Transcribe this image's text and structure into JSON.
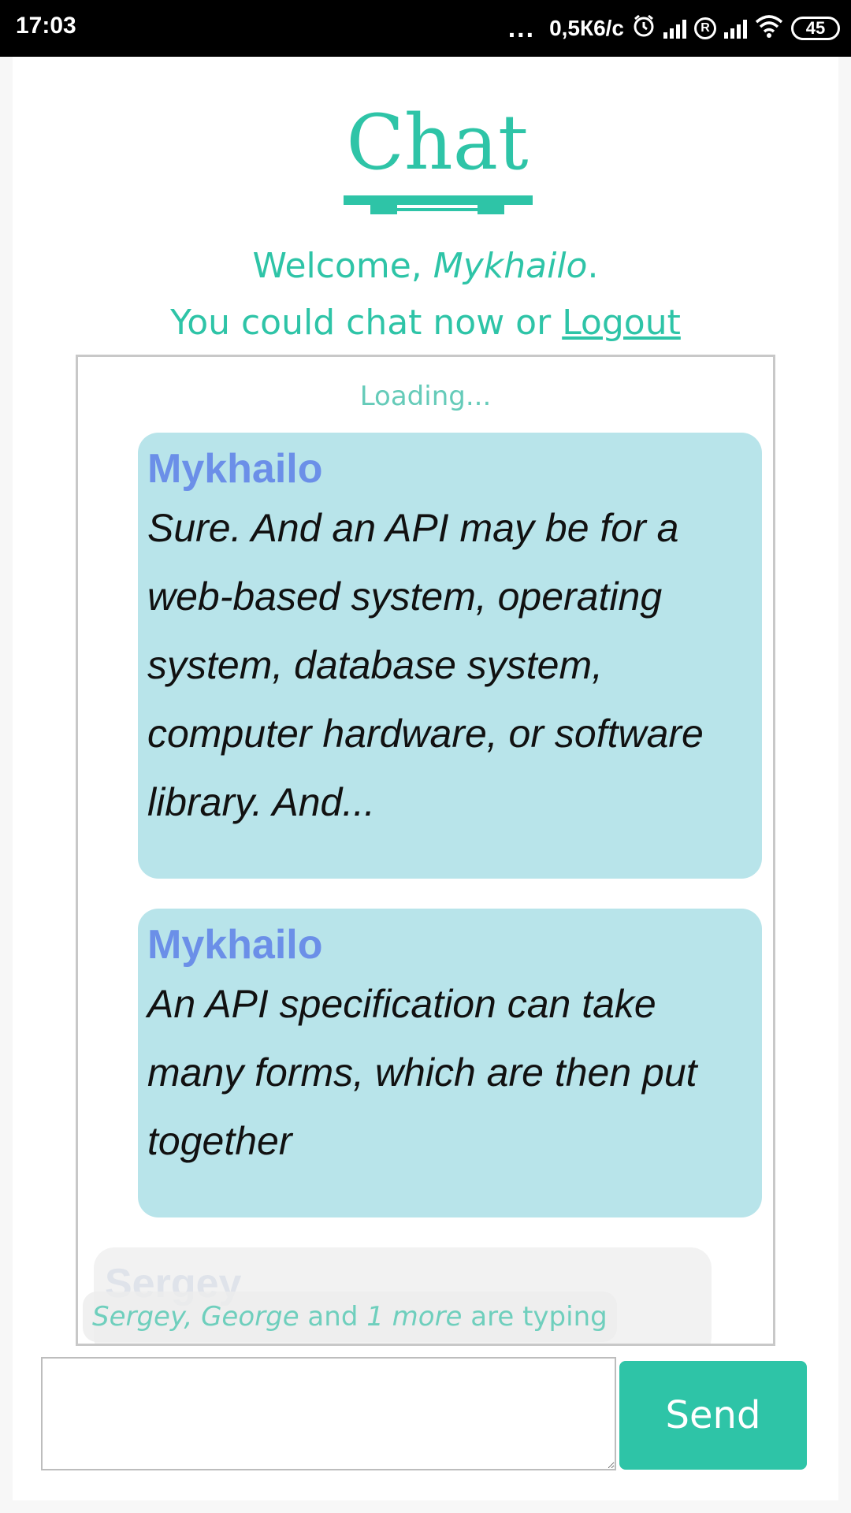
{
  "status_bar": {
    "time": "17:03",
    "more": "...",
    "speed": "0,5К6/с",
    "roaming": "R",
    "battery": "45",
    "icons": [
      "alarm-icon",
      "signal-icon",
      "roaming-icon",
      "signal-icon",
      "wifi-icon",
      "battery-icon"
    ]
  },
  "header": {
    "logo_text": "Chat",
    "welcome_prefix": "Welcome, ",
    "username": "Mykhailo",
    "welcome_suffix": ".",
    "line2_prefix": "You could chat now or ",
    "logout_label": "Logout"
  },
  "chat": {
    "loading": "Loading...",
    "messages": [
      {
        "author": "Mykhailo",
        "text": "Sure. And an API may be for a web-based system, operating system, database system, computer hardware, or software library. And..."
      },
      {
        "author": "Mykhailo",
        "text": "An API specification can take many forms, which are then put together"
      },
      {
        "author": "Sergey"
      }
    ],
    "typing": {
      "names": "Sergey, George",
      "and": " and ",
      "more": "1 more",
      "suffix": " are typing"
    }
  },
  "composer": {
    "value": "",
    "send_label": "Send"
  },
  "colors": {
    "accent": "#2ec4a7",
    "bubble": "#b8e4ea",
    "author": "#6b8fe8"
  }
}
